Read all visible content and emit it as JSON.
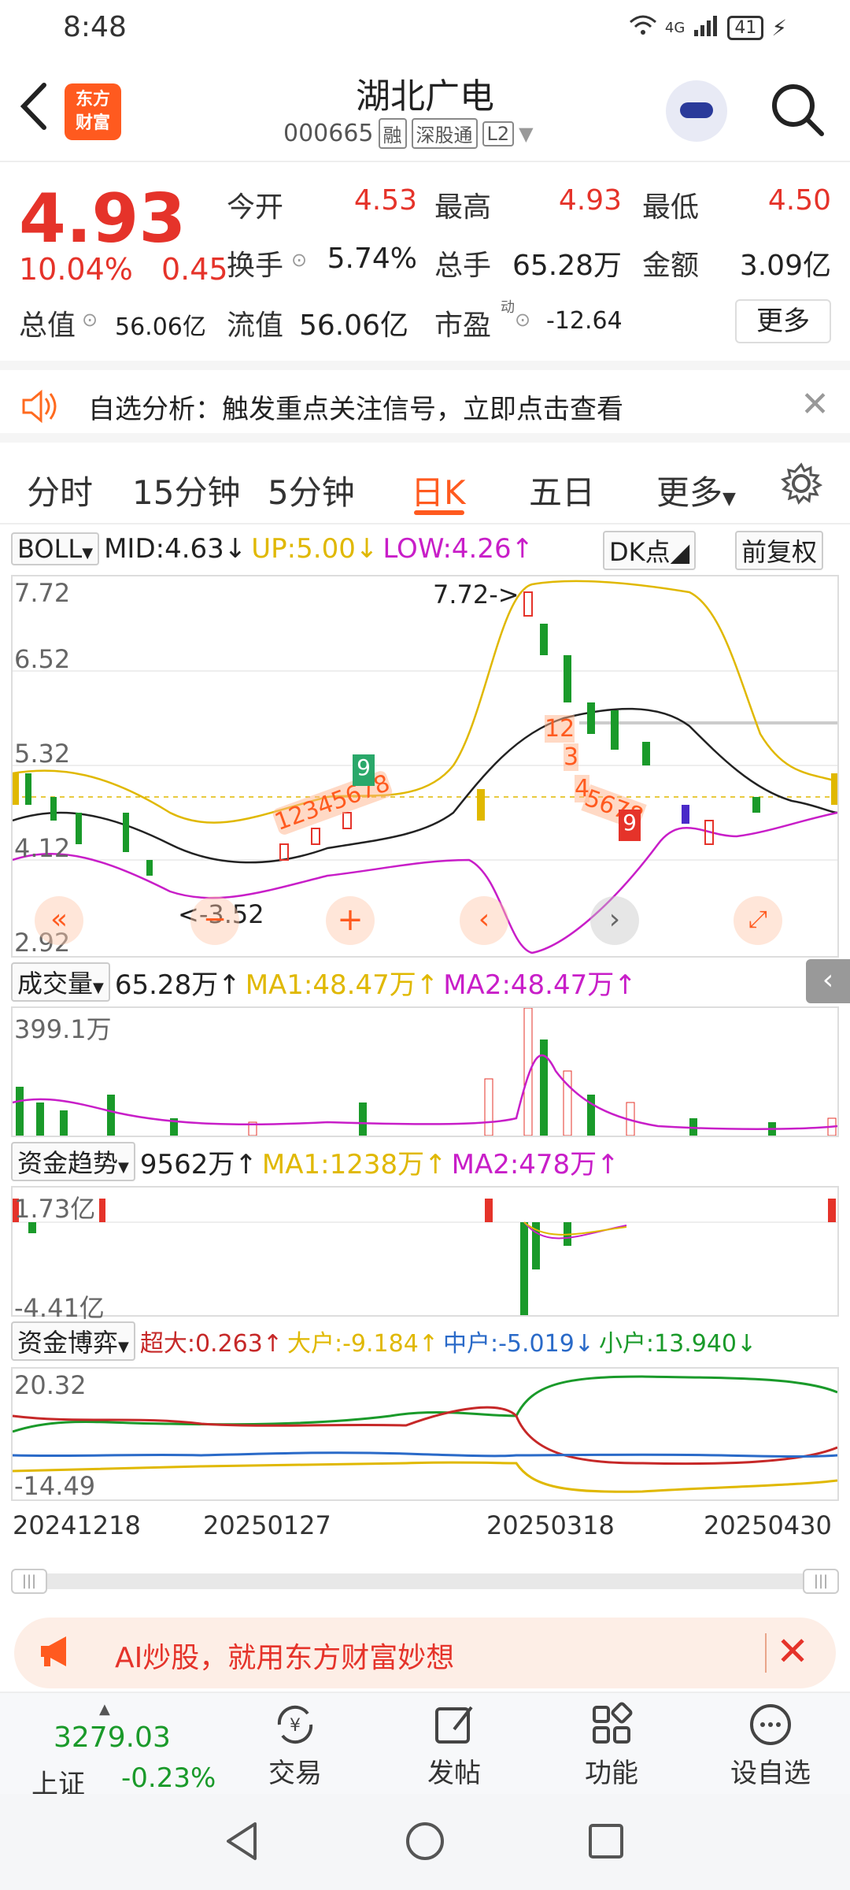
{
  "status": {
    "time": "8:48",
    "signal": "4G",
    "battery": "41"
  },
  "header": {
    "logo_line1": "东方",
    "logo_line2": "财富",
    "name": "湖北广电",
    "code": "000665",
    "tags": [
      "融",
      "深股通",
      "L2"
    ]
  },
  "quote": {
    "price": "4.93",
    "pct": "10.04%",
    "chg": "0.45",
    "open_label": "今开",
    "open": "4.53",
    "high_label": "最高",
    "high": "4.93",
    "low_label": "最低",
    "low": "4.50",
    "turnover_label": "换手",
    "turnover": "5.74%",
    "volume_label": "总手",
    "volume": "65.28万",
    "amount_label": "金额",
    "amount": "3.09亿",
    "mktcap_label": "总值",
    "mktcap": "56.06亿",
    "float_label": "流值",
    "float": "56.06亿",
    "pe_label": "市盈",
    "pe_sup": "动",
    "pe": "-12.64",
    "more_label": "更多"
  },
  "alert": {
    "text": "自选分析：触发重点关注信号，立即点击查看"
  },
  "tabs": [
    {
      "label": "分时"
    },
    {
      "label": "15分钟"
    },
    {
      "label": "5分钟"
    },
    {
      "label": "日K"
    },
    {
      "label": "五日"
    },
    {
      "label": "更多"
    }
  ],
  "boll": {
    "selector": "BOLL",
    "mid": "MID:4.63",
    "up": "UP:5.00",
    "low": "LOW:4.26",
    "dk": "DK点",
    "adj": "前复权",
    "ylabels": [
      "7.72",
      "6.52",
      "5.32",
      "4.12",
      "2.92"
    ],
    "high_marker": "7.72->",
    "low_marker": "<-3.52",
    "td_left": "12345678",
    "td_nine_left": "9",
    "td_right_top": "12",
    "td_right_3": "3",
    "td_right_4": "4",
    "td_right_5678": "5678",
    "td_nine_right": "9"
  },
  "volume": {
    "selector": "成交量",
    "value": "65.28万",
    "ma1": "MA1:48.47万",
    "ma2": "MA2:48.47万",
    "ymax": "399.1万"
  },
  "fund_trend": {
    "selector": "资金趋势",
    "value": "9562万",
    "ma1": "MA1:1238万",
    "ma2": "MA2:478万",
    "ymax": "1.73亿",
    "ymin": "-4.41亿"
  },
  "fund_game": {
    "selector": "资金博弈",
    "super": "超大:0.263",
    "large": "大户:-9.184",
    "medium": "中户:-5.019",
    "small": "小户:13.940",
    "ymax": "20.32",
    "ymin": "-14.49"
  },
  "dates": [
    "20241218",
    "20250127",
    "20250318",
    "20250430"
  ],
  "banner": {
    "text": "AI炒股，就用东方财富妙想"
  },
  "toolbar": {
    "index_value": "3279.03",
    "index_name": "上证",
    "index_change": "-0.23%",
    "items": [
      {
        "label": "交易"
      },
      {
        "label": "发帖"
      },
      {
        "label": "功能"
      },
      {
        "label": "设自选"
      }
    ]
  },
  "colors": {
    "up": "#e5332a",
    "down": "#1a9a2a",
    "accent": "#ff5a1f",
    "boll_up": "#e0b800",
    "boll_low": "#c81ec8"
  }
}
